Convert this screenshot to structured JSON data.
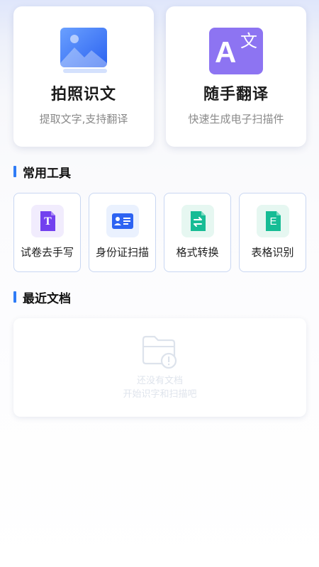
{
  "features": [
    {
      "title": "拍照识文",
      "subtitle": "提取文字,支持翻译",
      "icon": "image-icon",
      "color": "#3d74f5"
    },
    {
      "title": "随手翻译",
      "subtitle": "快速生成电子扫描件",
      "icon": "translate-icon",
      "glyph_latin": "A",
      "glyph_cjk": "文",
      "color": "#8d74f2"
    }
  ],
  "tools_section": {
    "title": "常用工具"
  },
  "tools": [
    {
      "label": "试卷去手写",
      "icon": "document-t-icon",
      "glyph": "T",
      "color": "#7240ef",
      "bg": "#f1ecfd"
    },
    {
      "label": "身份证扫描",
      "icon": "id-card-icon",
      "color": "#2d63f2",
      "bg": "#eaf1fe"
    },
    {
      "label": "格式转换",
      "icon": "file-convert-icon",
      "color": "#17bc95",
      "bg": "#e6f7f1"
    },
    {
      "label": "表格识别",
      "icon": "spreadsheet-e-icon",
      "glyph": "E",
      "color": "#17bc95",
      "bg": "#e6f7f1"
    }
  ],
  "recent_section": {
    "title": "最近文档"
  },
  "recent_empty": {
    "line1": "还没有文档",
    "line2": "开始识字和扫描吧",
    "icon": "empty-folder-icon"
  }
}
